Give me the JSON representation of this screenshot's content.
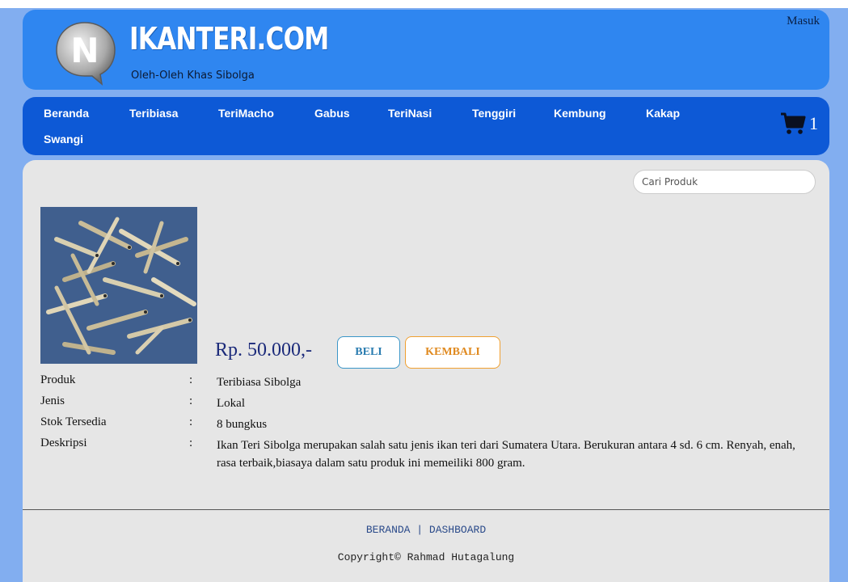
{
  "header": {
    "site_title": "IKANTERI.COM",
    "tagline": "Oleh-Oleh Khas Sibolga",
    "logo_letter": "N",
    "login_label": "Masuk"
  },
  "nav": {
    "items": [
      {
        "label": "Beranda"
      },
      {
        "label": "Teribiasa"
      },
      {
        "label": "TeriMacho"
      },
      {
        "label": "Gabus"
      },
      {
        "label": "TeriNasi"
      },
      {
        "label": "Tenggiri"
      },
      {
        "label": "Kembung"
      },
      {
        "label": "Kakap"
      },
      {
        "label": "Swangi"
      }
    ],
    "cart_icon": "shopping-cart-icon",
    "cart_count": "1"
  },
  "search": {
    "placeholder": "Cari Produk"
  },
  "product": {
    "price": "Rp. 50.000,-",
    "buy_label": "BELI",
    "back_label": "KEMBALI",
    "image_icon": "dried-anchovy-photo",
    "details": [
      {
        "label": "Produk",
        "sep": ":",
        "value": "Teribiasa Sibolga"
      },
      {
        "label": "Jenis",
        "sep": ":",
        "value": "Lokal"
      },
      {
        "label": "Stok Tersedia",
        "sep": ":",
        "value": "8 bungkus"
      },
      {
        "label": "Deskripsi",
        "sep": ":",
        "value": "Ikan Teri Sibolga merupakan salah satu jenis ikan teri dari Sumatera Utara. Berukuran antara 4 sd. 6 cm. Renyah, enah, rasa terbaik,biasaya dalam satu produk ini memeiliki 800 gram."
      }
    ]
  },
  "footer": {
    "link_home": "BERANDA",
    "separator": "|",
    "link_dashboard": "DASHBOARD",
    "copyright": "Copyright© Rahmad Hutagalung"
  },
  "colors": {
    "page_bg": "#82aef0",
    "header_bg": "#2f86f0",
    "nav_bg": "#0d59d6",
    "content_bg": "#e6e6e6",
    "price": "#1b2a7a",
    "buy_border": "#3a96c8",
    "back_border": "#f0a030"
  }
}
